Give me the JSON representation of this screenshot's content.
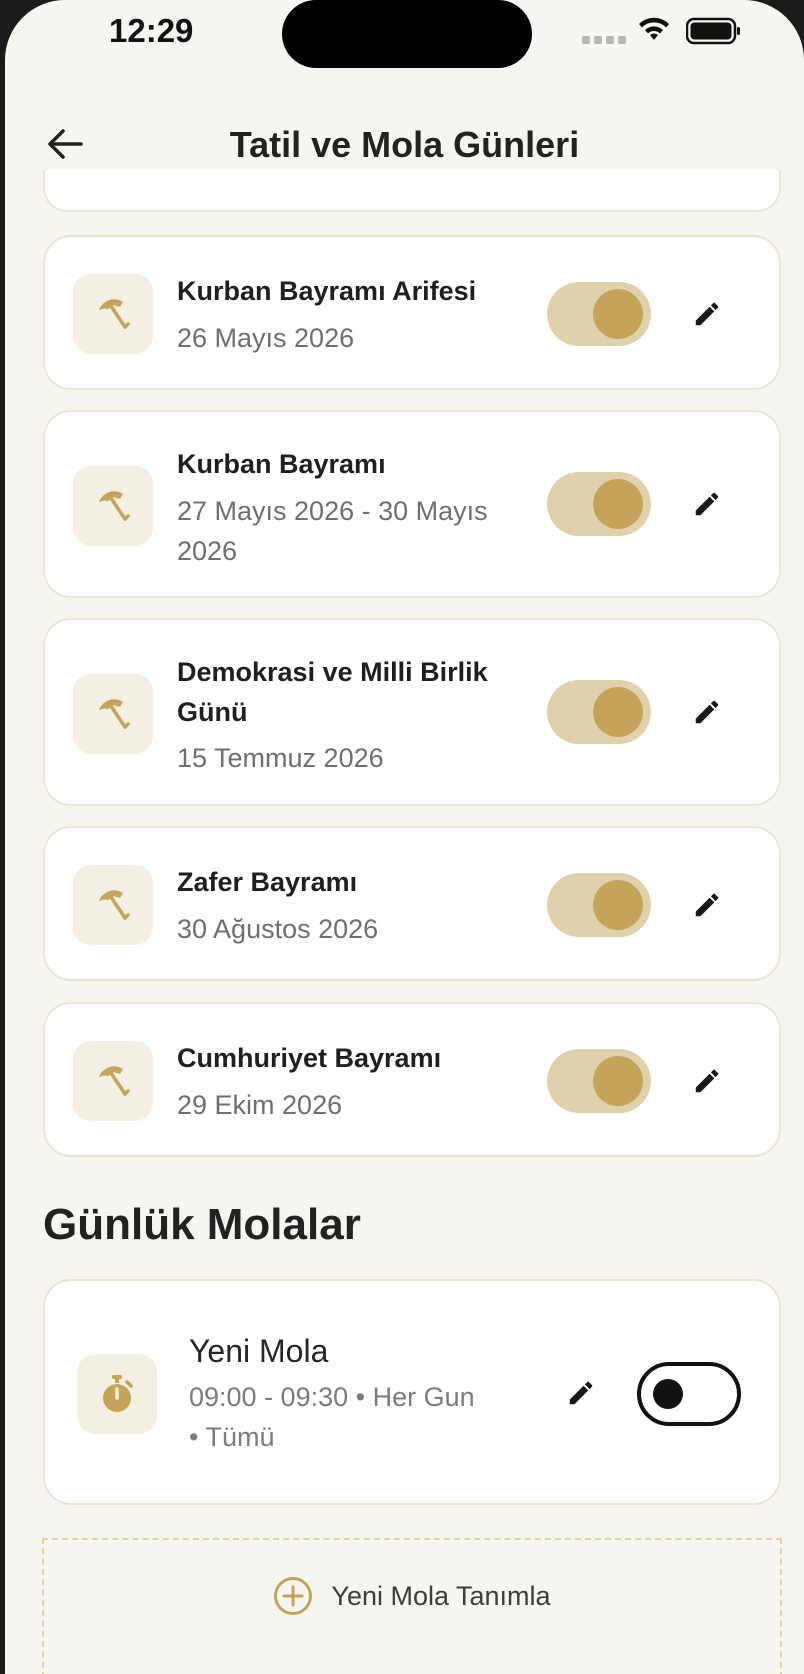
{
  "status_bar": {
    "time": "12:29"
  },
  "header": {
    "title": "Tatil ve Mola Günleri"
  },
  "holidays": [
    {
      "title": "Kurban Bayramı Arifesi",
      "date": "26 Mayıs 2026",
      "enabled": true
    },
    {
      "title": "Kurban Bayramı",
      "date": "27 Mayıs 2026 - 30 Mayıs 2026",
      "enabled": true
    },
    {
      "title": "Demokrasi ve Milli Birlik Günü",
      "date": "15 Temmuz 2026",
      "enabled": true
    },
    {
      "title": "Zafer Bayramı",
      "date": "30 Ağustos 2026",
      "enabled": true
    },
    {
      "title": "Cumhuriyet Bayramı",
      "date": "29 Ekim 2026",
      "enabled": true
    }
  ],
  "daily_breaks": {
    "section_title": "Günlük Molalar",
    "items": [
      {
        "title": "Yeni Mola",
        "details": "09:00 - 09:30 • Her Gun • Tümü",
        "enabled": false
      }
    ]
  },
  "add_break": {
    "label": "Yeni Mola Tanımla"
  },
  "colors": {
    "accent": "#c4a45a",
    "toggle_track": "#dfd1ac",
    "background": "#f7f5f0"
  },
  "icons": {
    "holiday": "umbrella-icon",
    "break": "stopwatch-icon",
    "edit": "pencil-icon",
    "back": "arrow-left-icon",
    "add": "plus-circle-icon"
  }
}
